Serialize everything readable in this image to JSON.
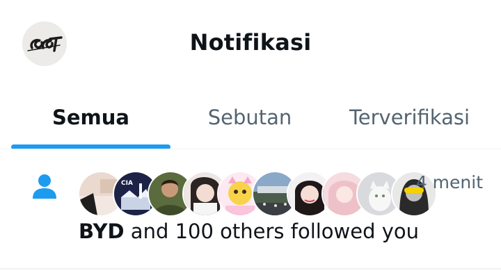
{
  "header": {
    "title": "Notifikasi",
    "profile_avatar_icon": "profile-logo-icon"
  },
  "tabs": [
    {
      "label": "Semua",
      "active": true
    },
    {
      "label": "Sebutan",
      "active": false
    },
    {
      "label": "Terverifikasi",
      "active": false
    }
  ],
  "notification": {
    "type_icon": "person-icon",
    "type_icon_color": "#1d9bf0",
    "time": "4 menit",
    "actor": "BYD",
    "message": " and 100 others followed you",
    "avatars": [
      "avatar-1",
      "avatar-cia",
      "avatar-3",
      "avatar-4",
      "avatar-5",
      "avatar-6",
      "avatar-7",
      "avatar-8",
      "avatar-cat",
      "avatar-10"
    ]
  },
  "colors": {
    "accent": "#1d9bf0",
    "text_primary": "#0f1419",
    "text_secondary": "#536471"
  }
}
